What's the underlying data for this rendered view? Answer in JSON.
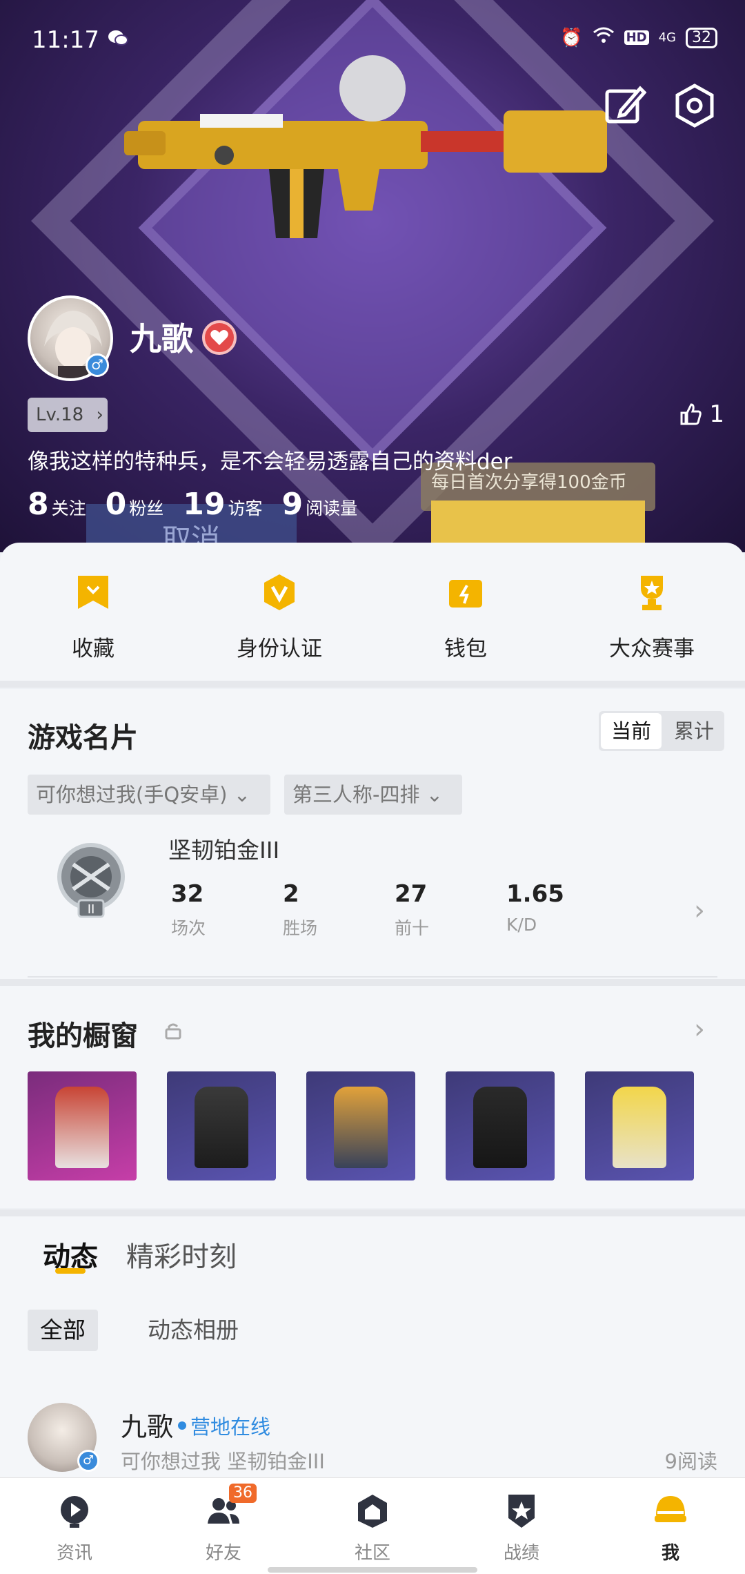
{
  "status_bar": {
    "time": "11:17",
    "battery": "32",
    "network": "4G",
    "hd": "HD"
  },
  "profile": {
    "username": "九歌",
    "gender_symbol": "♂",
    "level": "Lv.18",
    "likes": "1",
    "bio": "像我这样的特种兵，是不会轻易透露自己的资料der",
    "stats": [
      {
        "value": "8",
        "label": "关注"
      },
      {
        "value": "0",
        "label": "粉丝"
      },
      {
        "value": "19",
        "label": "访客"
      },
      {
        "value": "9",
        "label": "阅读量"
      }
    ]
  },
  "hero_overlay": {
    "share_banner": "每日首次分享得100金币",
    "cancel_label": "取消"
  },
  "quick_actions": [
    {
      "label": "收藏",
      "icon": "bookmark-icon"
    },
    {
      "label": "身份认证",
      "icon": "verified-badge-icon"
    },
    {
      "label": "钱包",
      "icon": "wallet-icon"
    },
    {
      "label": "大众赛事",
      "icon": "trophy-icon"
    }
  ],
  "game_card": {
    "title": "游戏名片",
    "toggle": {
      "current": "当前",
      "total": "累计"
    },
    "server_select": "可你想过我(手Q安卓)",
    "mode_select": "第三人称-四排",
    "rank_name": "坚韧铂金III",
    "stats": [
      {
        "value": "32",
        "label": "场次"
      },
      {
        "value": "2",
        "label": "胜场"
      },
      {
        "value": "27",
        "label": "前十"
      },
      {
        "value": "1.65",
        "label": "K/D"
      }
    ]
  },
  "showcase": {
    "title": "我的橱窗"
  },
  "feed": {
    "tabs": [
      "动态",
      "精彩时刻"
    ],
    "filters": [
      "全部",
      "动态相册"
    ],
    "post": {
      "name": "九歌",
      "status": "营地在线",
      "sub": "可你想过我   坚韧铂金III",
      "reads": "9阅读"
    }
  },
  "tabbar": {
    "items": [
      {
        "label": "资讯",
        "icon": "news-icon"
      },
      {
        "label": "好友",
        "icon": "friends-icon",
        "badge": "36"
      },
      {
        "label": "社区",
        "icon": "community-icon"
      },
      {
        "label": "战绩",
        "icon": "record-icon"
      },
      {
        "label": "我",
        "icon": "me-icon"
      }
    ]
  },
  "colors": {
    "accent": "#f4b400",
    "online_blue": "#2f8be0",
    "badge_orange": "#f06a2a"
  }
}
